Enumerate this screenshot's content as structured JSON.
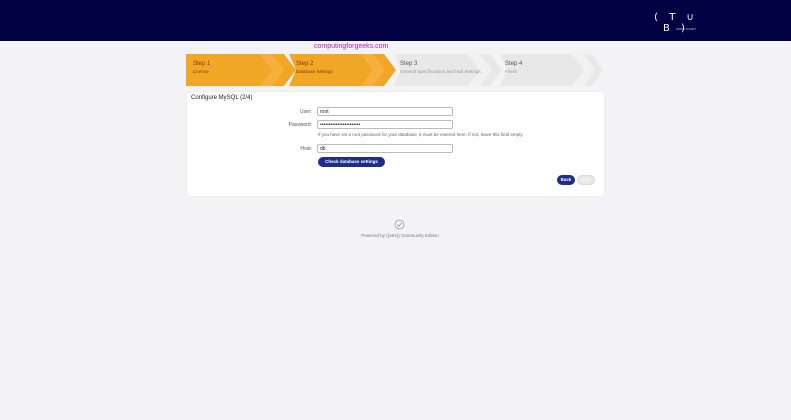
{
  "header": {
    "logo_text": "( T ∪ B )",
    "logo_sub": "OPEN TICKET"
  },
  "watermark": "computingforgeeks.com",
  "steps": [
    {
      "title": "Step 1",
      "subtitle": "License"
    },
    {
      "title": "Step 2",
      "subtitle": "Database Settings"
    },
    {
      "title": "Step 3",
      "subtitle": "General Specifications and Mail Settings"
    },
    {
      "title": "Step 4",
      "subtitle": "Finish"
    }
  ],
  "form": {
    "title": "Configure MySQL (2/4)",
    "user_label": "User:",
    "user_value": "root",
    "password_label": "Password:",
    "password_value": "•••••••••••••••••••••••",
    "hint": "If you have set a root password for your database, it must be entered here. If not, leave this field empty.",
    "host_label": "Host:",
    "host_value": "db",
    "check_button": "Check database settings",
    "back_button": "Back",
    "next_button": "Next"
  },
  "footer": {
    "text": "Powered by ((otrs)) Community Edition",
    "icon": "check-circle-icon"
  },
  "colors": {
    "header_bg": "#010144",
    "active_step": "#f2a626",
    "inactive_step": "#e8e8e8",
    "primary_button": "#1e2d8a"
  }
}
